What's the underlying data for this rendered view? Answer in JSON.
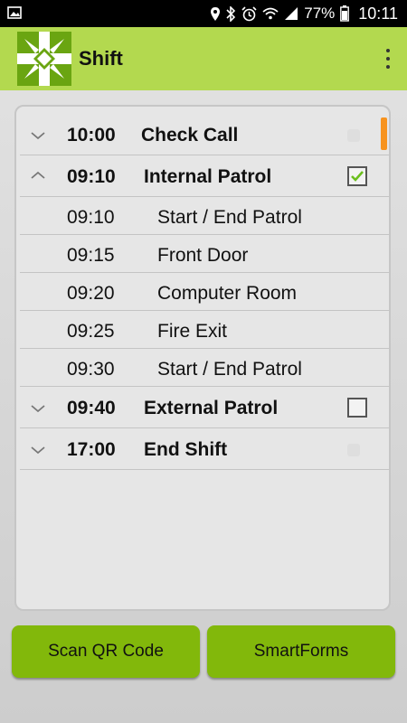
{
  "status_bar": {
    "battery": "77%",
    "time": "10:11"
  },
  "app_bar": {
    "title": "Shift",
    "menu_icon": "more-vert-icon"
  },
  "list": {
    "groups": [
      {
        "time": "10:00",
        "name": "Check Call",
        "expanded": false,
        "checkbox": "hidden"
      },
      {
        "time": "09:10",
        "name": "Internal Patrol",
        "expanded": true,
        "checkbox": "checked",
        "children": [
          {
            "time": "09:10",
            "name": "Start / End Patrol"
          },
          {
            "time": "09:15",
            "name": "Front Door"
          },
          {
            "time": "09:20",
            "name": "Computer Room"
          },
          {
            "time": "09:25",
            "name": "Fire Exit"
          },
          {
            "time": "09:30",
            "name": "Start / End Patrol"
          }
        ]
      },
      {
        "time": "09:40",
        "name": "External Patrol",
        "expanded": false,
        "checkbox": "unchecked"
      },
      {
        "time": "17:00",
        "name": "End Shift",
        "expanded": false,
        "checkbox": "hidden"
      }
    ]
  },
  "buttons": {
    "scan_qr": "Scan QR Code",
    "smartforms": "SmartForms"
  },
  "colors": {
    "app_bar": "#b3d94f",
    "button": "#82b80b",
    "logo_green": "#6aa511",
    "scroll_indicator": "#f7931e",
    "check_green": "#6cbf1e"
  }
}
